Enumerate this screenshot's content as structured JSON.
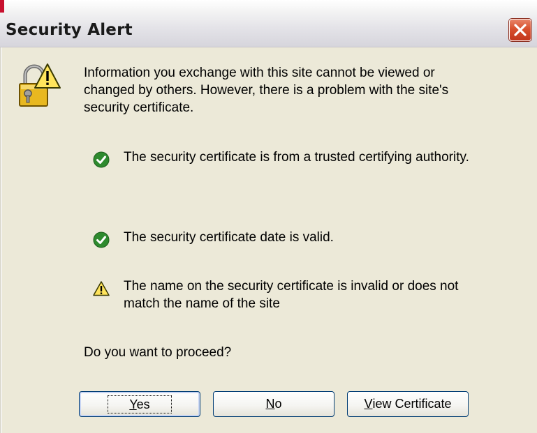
{
  "window": {
    "title": "Security Alert"
  },
  "message": {
    "intro": "Information you exchange with this site cannot be viewed or\nchanged by others. However, there is a problem with the site's\nsecurity certificate.",
    "checks": [
      {
        "icon": "check-icon",
        "status": "ok",
        "text": "The security certificate is from a trusted certifying authority."
      },
      {
        "icon": "check-icon",
        "status": "ok",
        "text": "The security certificate date is valid."
      },
      {
        "icon": "warning-icon",
        "status": "warning",
        "text": "The name on the security certificate is invalid or does not\nmatch the name of the site"
      }
    ],
    "question": "Do you want to proceed?"
  },
  "buttons": {
    "yes": {
      "accel": "Y",
      "rest": "es"
    },
    "no": {
      "accel": "N",
      "rest": "o"
    },
    "view_certificate": {
      "accel": "V",
      "rest": "iew Certificate"
    }
  },
  "colors": {
    "dialog_bg": "#ece9d8",
    "close_button": "#d8502e",
    "check_green": "#2e8a2e",
    "warning_yellow": "#ffe45c",
    "button_border": "#003c74"
  }
}
